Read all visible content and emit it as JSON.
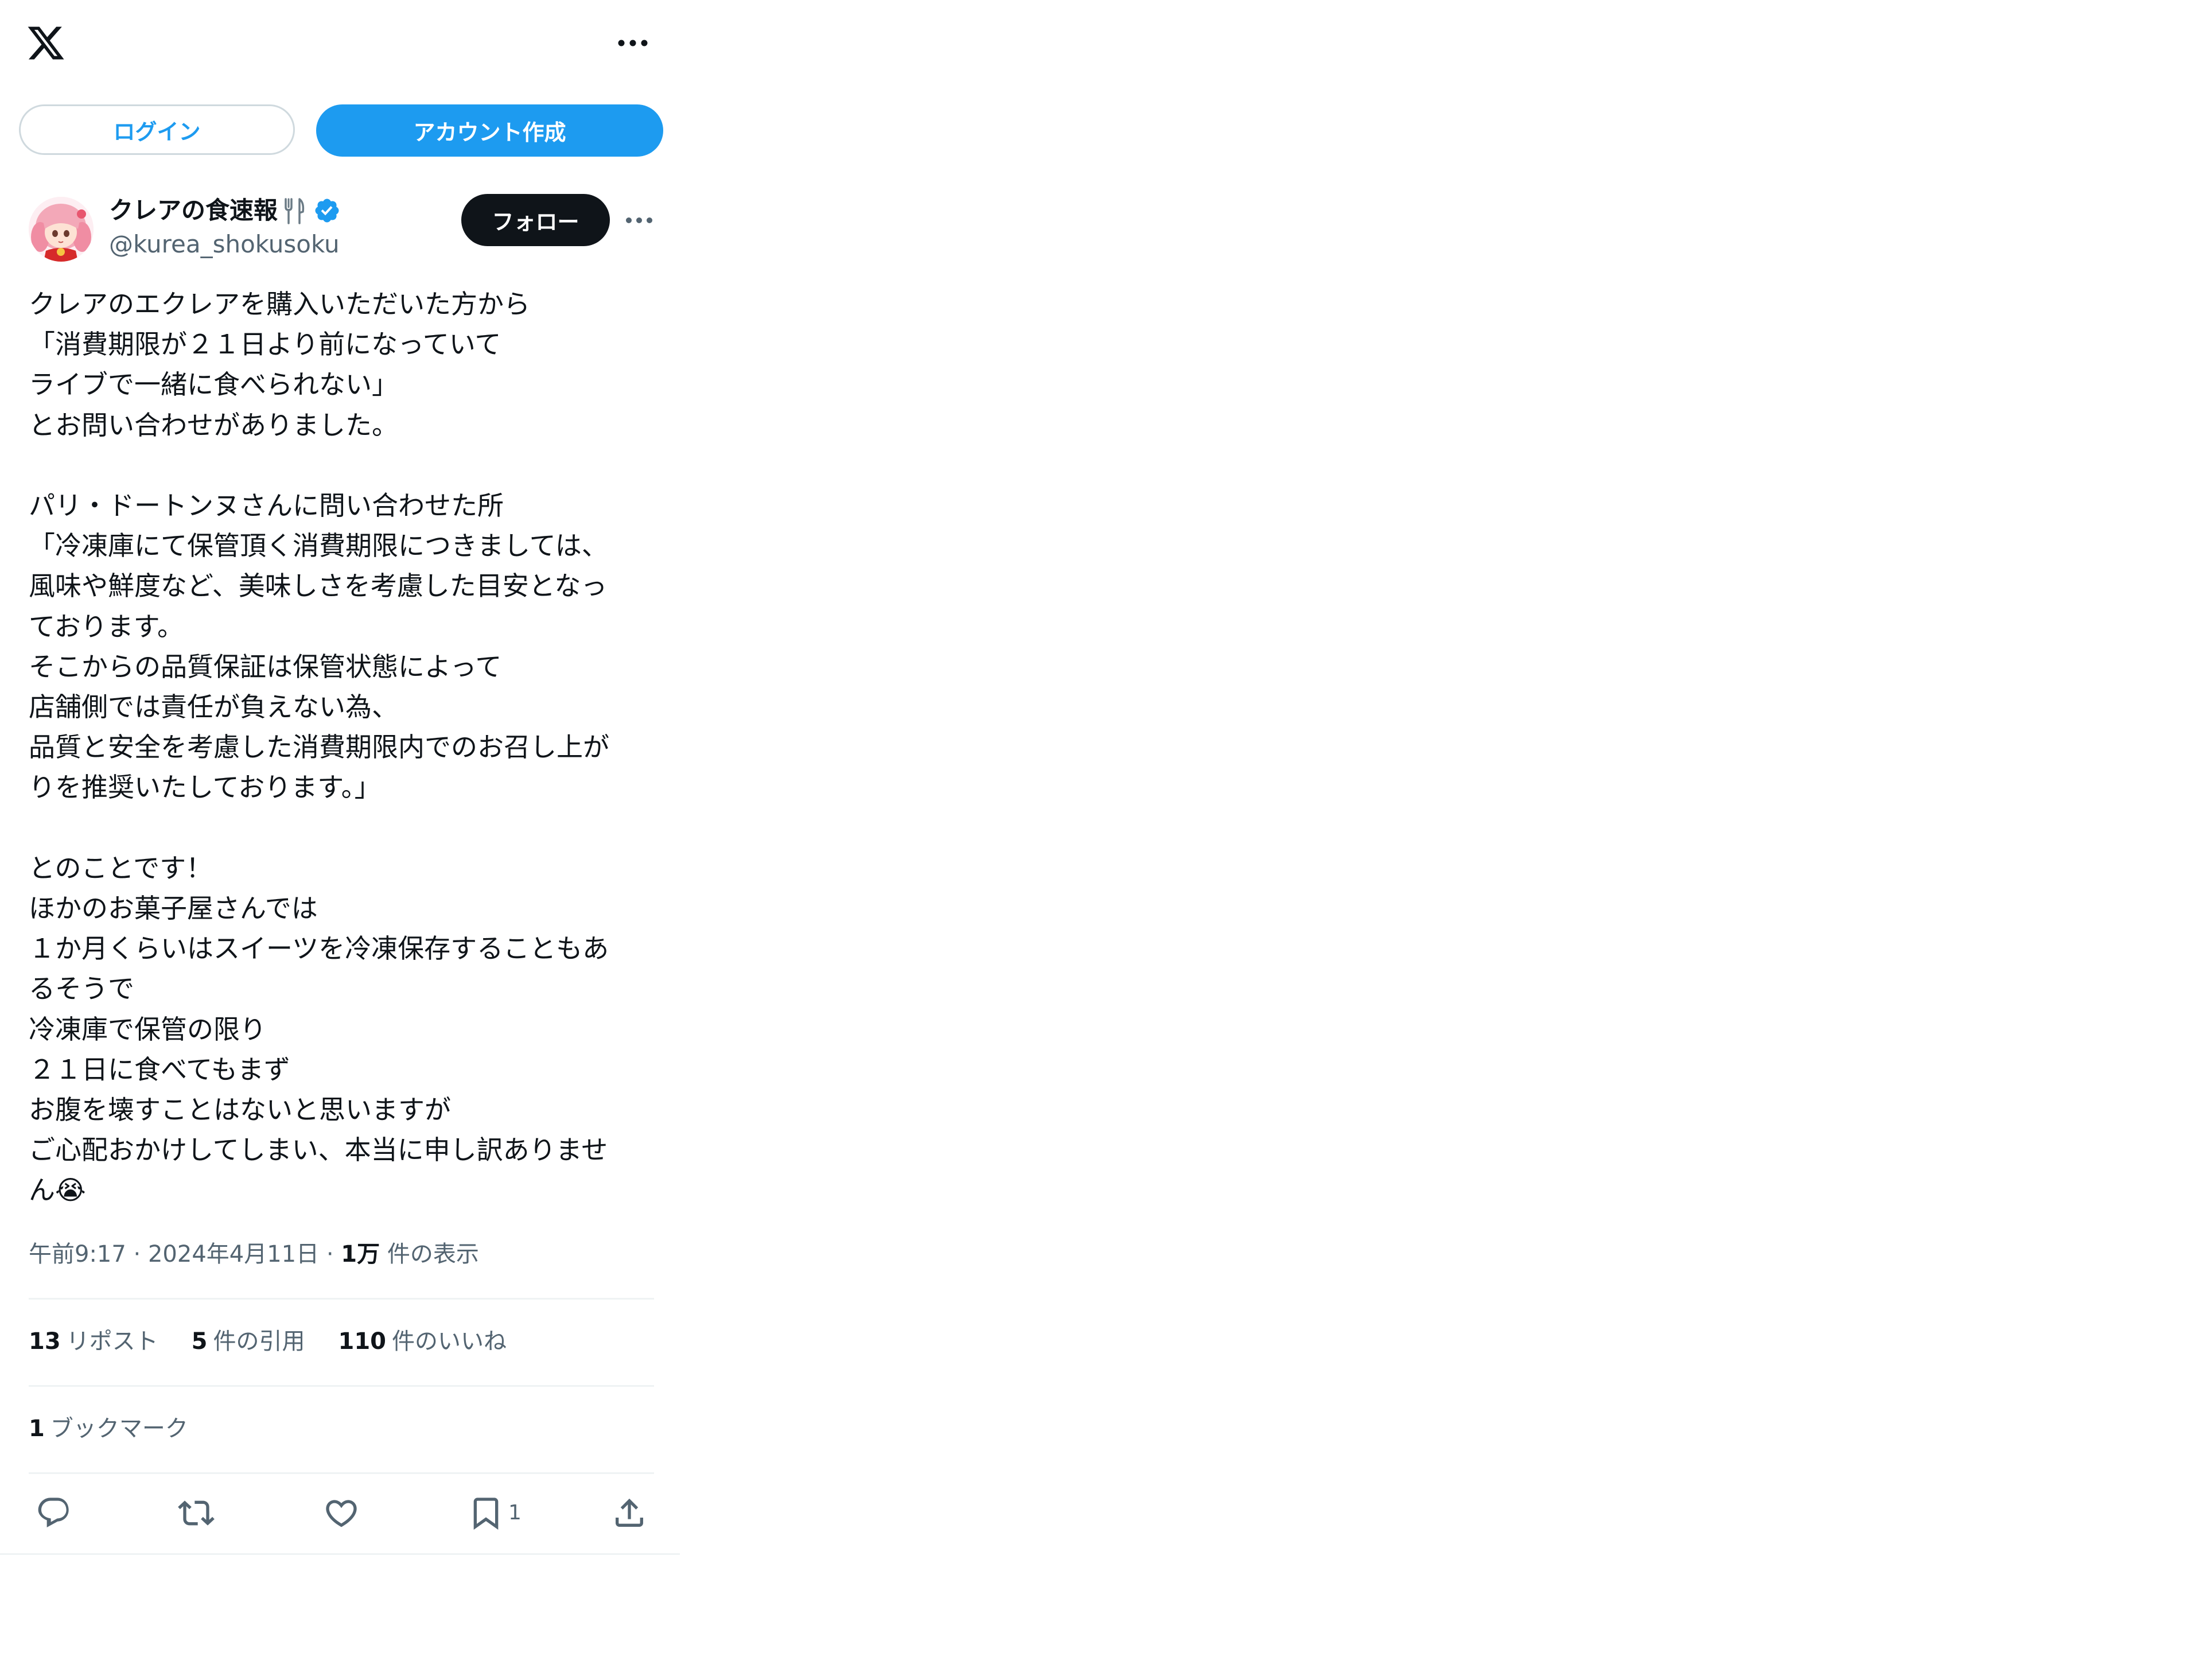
{
  "header": {
    "logo_icon": "x-logo-icon",
    "more_icon": "more-horizontal-icon"
  },
  "auth": {
    "login_label": "ログイン",
    "signup_label": "アカウント作成"
  },
  "author": {
    "display_name": "クレアの食速報",
    "name_emoji_icon": "fork-and-knife-icon",
    "verified_icon": "verified-badge-icon",
    "handle": "@kurea_shokusoku",
    "follow_label": "フォロー"
  },
  "tweet": {
    "text": "クレアのエクレアを購入いただいた方から\n「消費期限が２１日より前になっていて\nライブで一緒に食べられない」\nとお問い合わせがありました。\n\nパリ・ドートンヌさんに問い合わせた所\n「冷凍庫にて保管頂く消費期限につきましては、\n風味や鮮度など、美味しさを考慮した目安となっ\nております。\nそこからの品質保証は保管状態によって\n店舗側では責任が負えない為、\n品質と安全を考慮した消費期限内でのお召し上が\nりを推奨いたしております。」\n\nとのことです！\nほかのお菓子屋さんでは\n１か月くらいはスイーツを冷凍保存することもあ\nるそうで\n冷凍庫で保管の限り\n２１日に食べてもまず\nお腹を壊すことはないと思いますが\nご心配おかけしてしまい、本当に申し訳ありませ\nん😭",
    "time": "午前9:17",
    "date": "2024年4月11日",
    "views_count": "1万",
    "views_label": "件の表示"
  },
  "stats": {
    "reposts_count": "13",
    "reposts_label": "リポスト",
    "quotes_count": "5",
    "quotes_label": "件の引用",
    "likes_count": "110",
    "likes_label": "件のいいね",
    "bookmarks_count": "1",
    "bookmarks_label": "ブックマーク"
  },
  "actions": {
    "reply_icon": "reply-icon",
    "retweet_icon": "retweet-icon",
    "like_icon": "heart-icon",
    "bookmark_icon": "bookmark-icon",
    "bookmark_count": "1",
    "share_icon": "share-icon"
  },
  "colors": {
    "accent": "#1d9bf0",
    "text": "#0f1419",
    "muted": "#536471",
    "border": "#eff3f4"
  }
}
